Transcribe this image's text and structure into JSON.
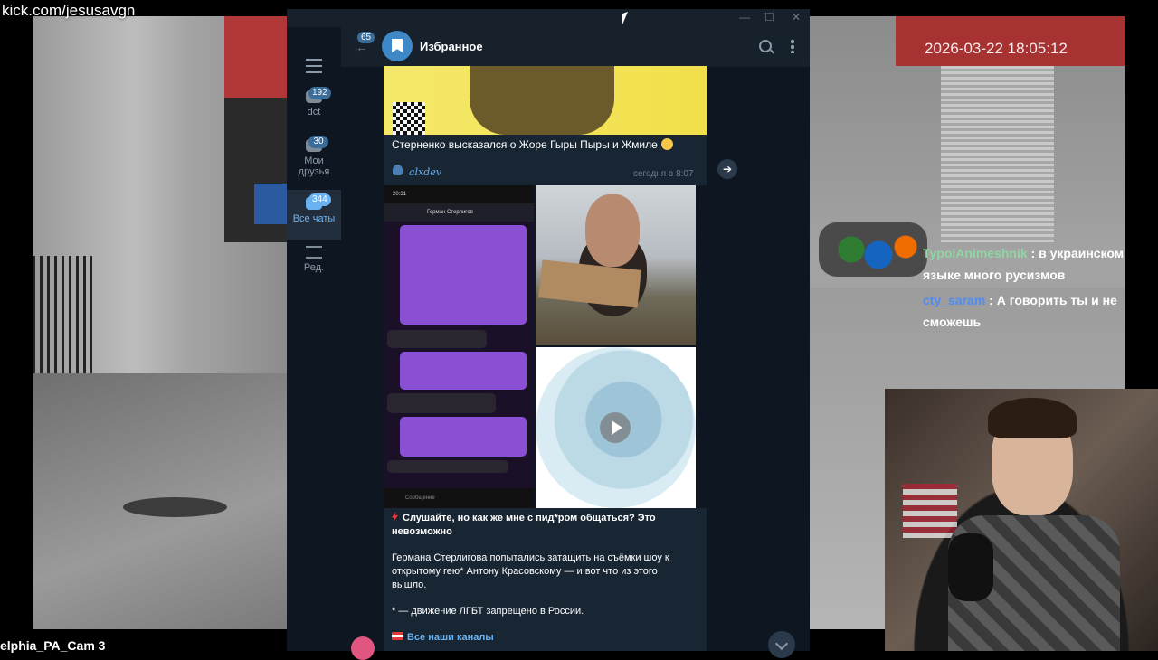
{
  "stream": {
    "channel_url": "kick.com/jesusavgn",
    "camera_label": "elphia_PA_Cam 3",
    "timestamp_overlay": "2026-03-22 18:05:12"
  },
  "chat_overlay": [
    {
      "user": "TypoiAnimeshnik",
      "text": ": в украинском языке много русизмов"
    },
    {
      "user": "cty_saram",
      "text": ": А говорить ты и не сможешь"
    }
  ],
  "telegram": {
    "sidebar": [
      {
        "label": "dct",
        "badge": "192"
      },
      {
        "label": "Мои друзья",
        "badge": "30"
      },
      {
        "label": "Все чаты",
        "badge": "344"
      },
      {
        "label": "Ред.",
        "badge": ""
      }
    ],
    "header": {
      "back_badge": "65",
      "title": "Избранное"
    },
    "messages": {
      "msg1_text": "Стерненко высказался о Жоре Гыры Пыры и Жмиле",
      "msg1_author": "alxdev",
      "msg1_time": "сегодня в 8:07",
      "shot_time": "20:31",
      "shot_contact": "Герман Стерлигов",
      "shot_input": "Сообщение",
      "msg2_title": "Слушайте, но как же мне с пид*ром общаться? Это невозможно",
      "msg2_body": "Германа Стерлигова попытались затащить на съёмки шоу к открытому гею* Антону Красовскому — и вот что из этого вышло.",
      "msg2_note": "* — движение ЛГБТ запрещено в России.",
      "msg2_link": "Все наши каналы"
    }
  },
  "colors": {
    "accent": "#6ab3f3",
    "bubble": "#182533",
    "window_bg": "#0e1621",
    "header_bg": "#17212b"
  }
}
